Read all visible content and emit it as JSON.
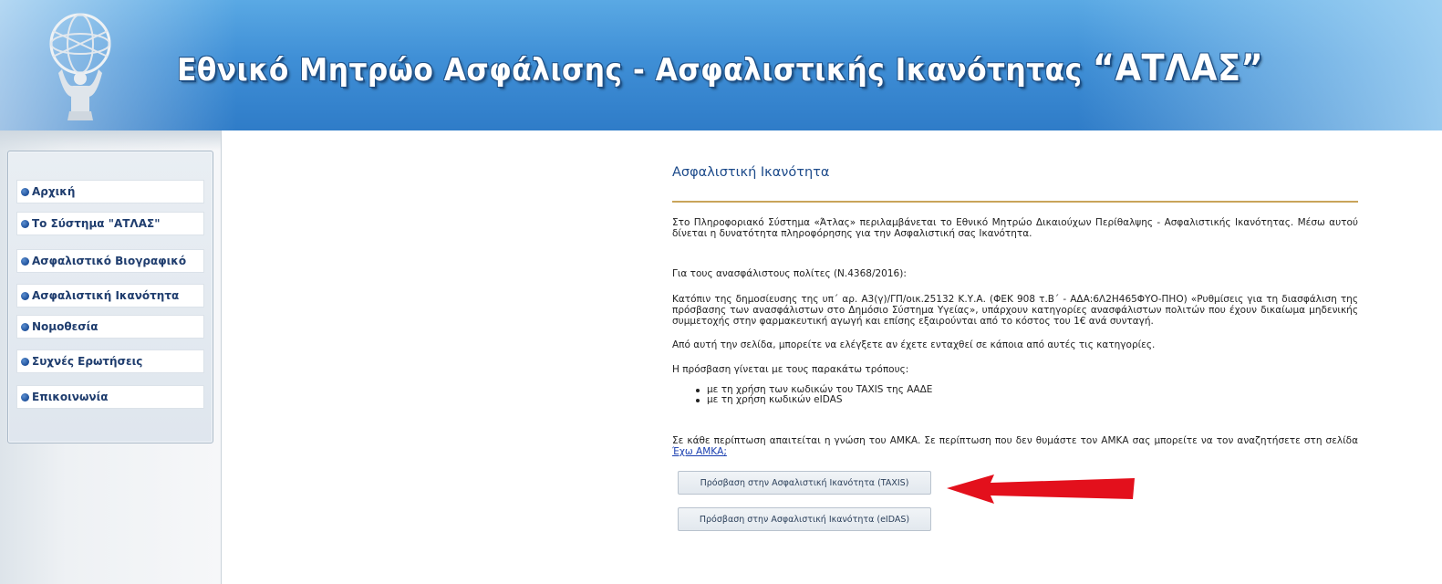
{
  "header": {
    "title_prefix": "Εθνικό Μητρώο Ασφάλισης - Ασφαλιστικής Ικανότητας ",
    "title_brand": "“ΑΤΛΑΣ”",
    "logo_icon": "atlas-globe-logo"
  },
  "sidebar": {
    "items": [
      {
        "label": "Αρχική"
      },
      {
        "label": "Το Σύστημα \"ΑΤΛΑΣ\""
      },
      {
        "label": "Ασφαλιστικό Βιογραφικό"
      },
      {
        "label": "Ασφαλιστική Ικανότητα"
      },
      {
        "label": "Νομοθεσία"
      },
      {
        "label": "Συχνές Ερωτήσεις"
      },
      {
        "label": "Επικοινωνία"
      }
    ]
  },
  "main": {
    "title": "Ασφαλιστική Ικανότητα",
    "intro": "Στο Πληροφοριακό Σύστημα «Άτλας» περιλαμβάνεται το Εθνικό Μητρώο Δικαιούχων Περίθαλψης - Ασφαλιστικής Ικανότητας. Μέσω αυτού δίνεται η δυνατότητα πληροφόρησης για την Ασφαλιστική σας Ικανότητα.",
    "uninsured_heading": "Για τους ανασφάλιστους πολίτες (Ν.4368/2016):",
    "decision_text": "Κατόπιν της δημοσίευσης της υπ΄ αρ. Α3(γ)/ΓΠ/οικ.25132 Κ.Υ.Α. (ΦΕΚ 908 τ.Β΄ - ΑΔΑ:6Λ2Η465ΦΥΟ-ΠΗΟ) «Ρυθμίσεις για τη διασφάλιση της πρόσβασης των ανασφάλιστων στο Δημόσιο Σύστημα Υγείας», υπάρχουν κατηγορίες ανασφάλιστων πολιτών που έχουν δικαίωμα μηδενικής συμμετοχής στην φαρμακευτική αγωγή και επίσης εξαιρούνται από το κόστος του 1€ ανά συνταγή.",
    "check_text": "Από αυτή την σελίδα, μπορείτε να ελέγξετε αν έχετε ενταχθεί σε κάποια από αυτές τις κατηγορίες.",
    "access_heading": "Η πρόσβαση γίνεται με τους παρακάτω τρόπους:",
    "access_methods": [
      "με τη χρήση των κωδικών του TAXIS της ΑΑΔΕ",
      "με τη χρήση κωδικών eIDAS"
    ],
    "amka_text": "Σε κάθε περίπτωση απαιτείται η γνώση του ΑΜΚΑ. Σε περίπτωση που δεν θυμάστε τον ΑΜΚΑ σας μπορείτε να τον αναζητήσετε στη σελίδα ",
    "amka_link": "Έχω ΑΜΚΑ;",
    "button_taxis": "Πρόσβαση στην Ασφαλιστική Ικανότητα (TAXIS)",
    "button_eidas": "Πρόσβαση στην Ασφαλιστική Ικανότητα (eIDAS)"
  },
  "annotation": {
    "icon": "red-arrow-left-icon",
    "color": "#e3101c"
  },
  "colors": {
    "header_blue": "#3f8fd6",
    "title_blue": "#1c4a8a",
    "rule_gold": "#c9a45a",
    "nav_text": "#1f3d6e"
  }
}
